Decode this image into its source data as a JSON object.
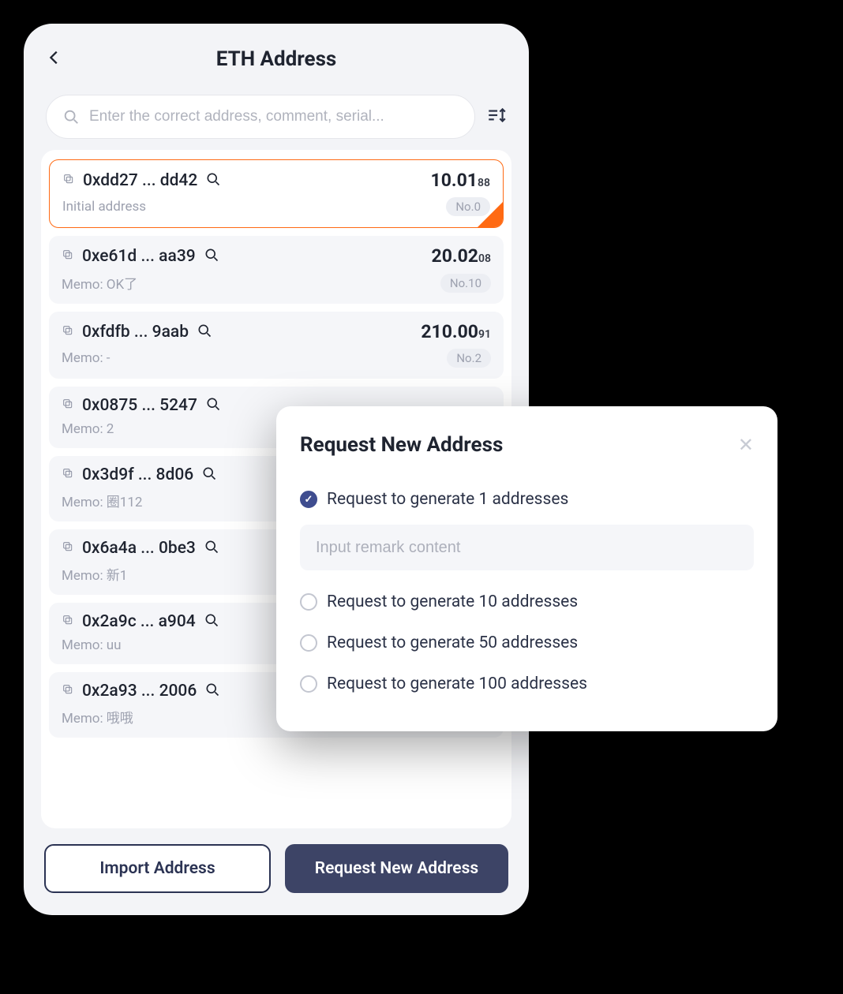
{
  "header": {
    "title": "ETH Address"
  },
  "search": {
    "placeholder": "Enter the correct address, comment, serial..."
  },
  "addresses": [
    {
      "addr": "0xdd27 ... dd42",
      "balance_main": "10.01",
      "balance_sub": "88",
      "memo": "Initial address",
      "no": "No.0",
      "selected": true
    },
    {
      "addr": "0xe61d ... aa39",
      "balance_main": "20.02",
      "balance_sub": "08",
      "memo": "Memo: OK了",
      "no": "No.10",
      "selected": false
    },
    {
      "addr": "0xfdfb ... 9aab",
      "balance_main": "210.00",
      "balance_sub": "91",
      "memo": "Memo: -",
      "no": "No.2",
      "selected": false
    },
    {
      "addr": "0x0875 ... 5247",
      "balance_main": "",
      "balance_sub": "",
      "memo": "Memo: 2",
      "no": "",
      "selected": false
    },
    {
      "addr": "0x3d9f ... 8d06",
      "balance_main": "",
      "balance_sub": "",
      "memo": "Memo: 圈112",
      "no": "",
      "selected": false
    },
    {
      "addr": "0x6a4a ... 0be3",
      "balance_main": "",
      "balance_sub": "",
      "memo": "Memo: 新1",
      "no": "",
      "selected": false
    },
    {
      "addr": "0x2a9c ... a904",
      "balance_main": "",
      "balance_sub": "",
      "memo": "Memo: uu",
      "no": "",
      "selected": false
    },
    {
      "addr": "0x2a93 ... 2006",
      "balance_main": "",
      "balance_sub": "",
      "memo": "Memo: 哦哦",
      "no": "",
      "selected": false
    }
  ],
  "buttons": {
    "import": "Import Address",
    "request": "Request New Address"
  },
  "dialog": {
    "title": "Request New Address",
    "remark_placeholder": "Input remark content",
    "options": [
      {
        "label": "Request to generate 1 addresses",
        "checked": true
      },
      {
        "label": "Request to generate 10 addresses",
        "checked": false
      },
      {
        "label": "Request to generate 50 addresses",
        "checked": false
      },
      {
        "label": "Request to generate 100 addresses",
        "checked": false
      }
    ]
  }
}
